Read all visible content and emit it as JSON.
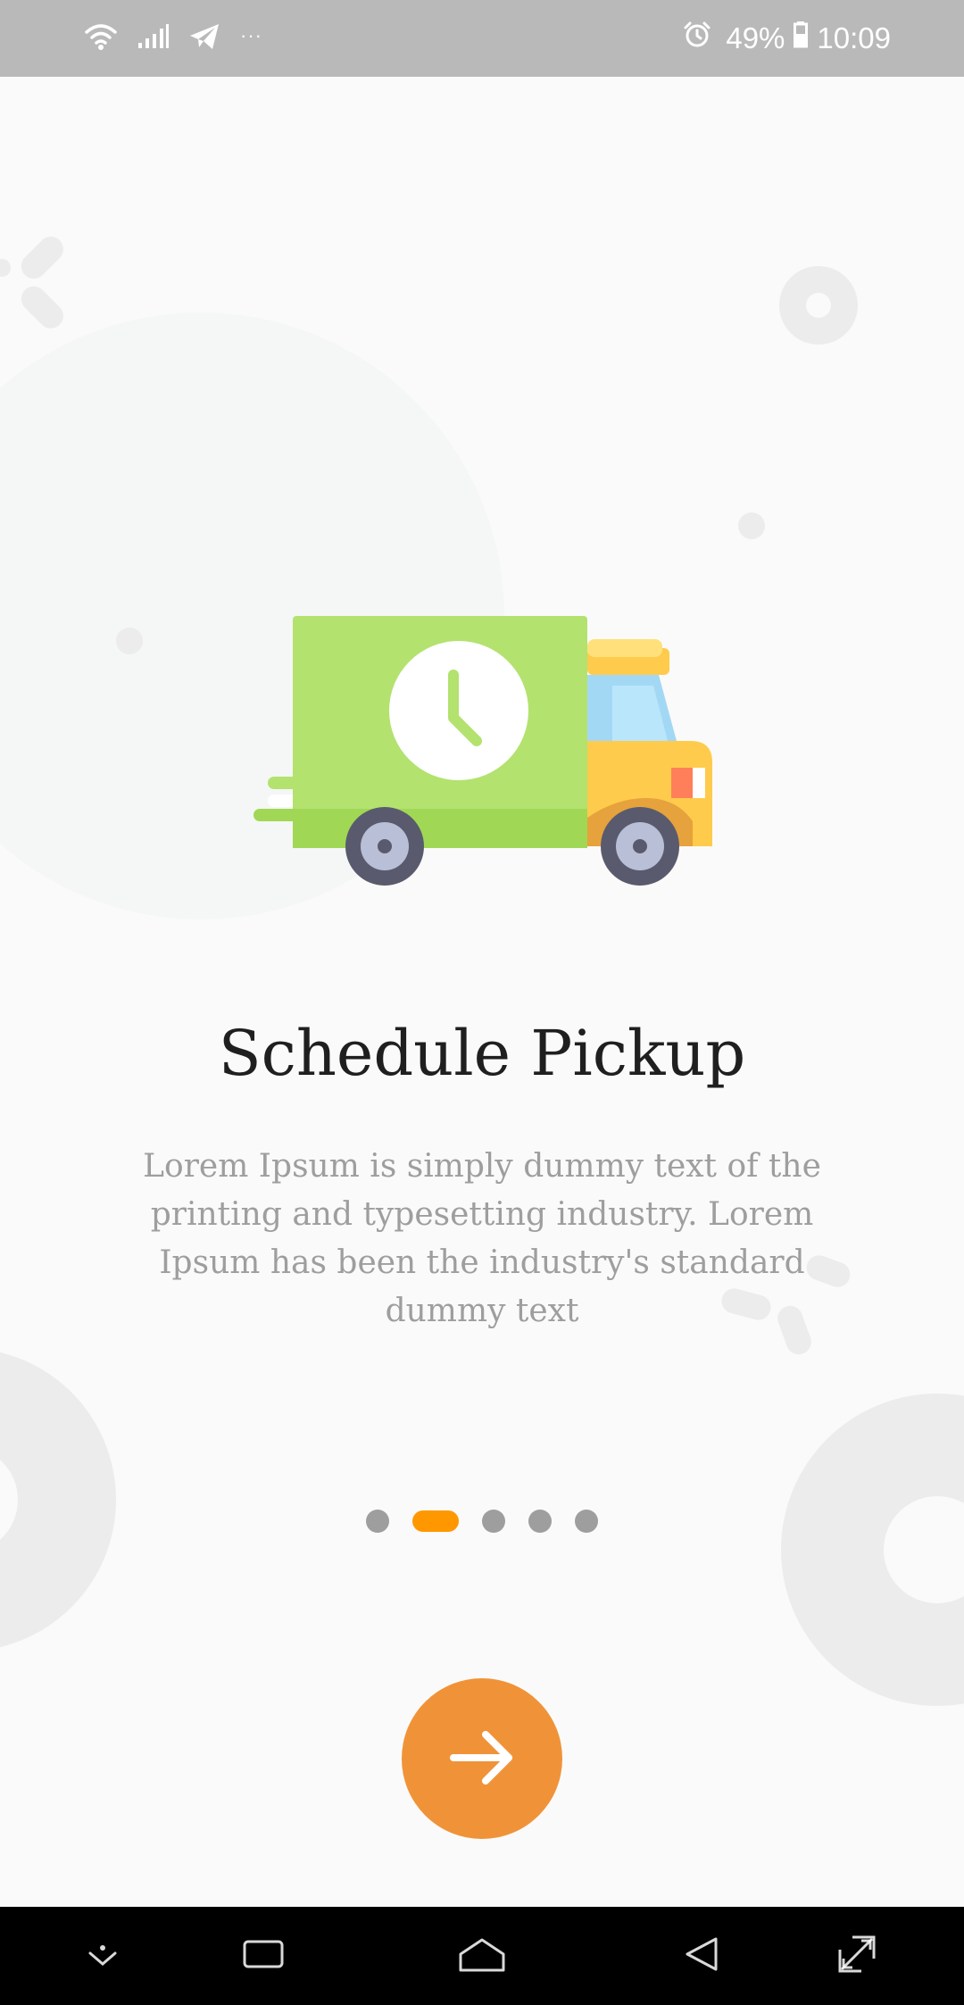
{
  "status_bar": {
    "more": "···",
    "battery": "49%",
    "time": "10:09"
  },
  "onboarding": {
    "title": "Schedule Pickup",
    "description": "Lorem Ipsum is simply dummy text of the printing and typesetting industry. Lorem Ipsum has been the industry's standard dummy text",
    "page_count": 5,
    "active_page": 2
  },
  "colors": {
    "accent": "#ff9800",
    "button": "#f09338",
    "truck_body": "#b3e26f",
    "truck_cab": "#ffcb4c",
    "inactive_dot": "#9e9e9e"
  },
  "icons": {
    "status_left": [
      "wifi-icon",
      "signal-icon",
      "telegram-icon"
    ],
    "status_right": [
      "alarm-icon",
      "battery-icon"
    ],
    "next": "arrow-right-icon",
    "nav": [
      "chevron-down-icon",
      "recent-apps-icon",
      "home-icon",
      "back-icon",
      "expand-icon"
    ]
  }
}
